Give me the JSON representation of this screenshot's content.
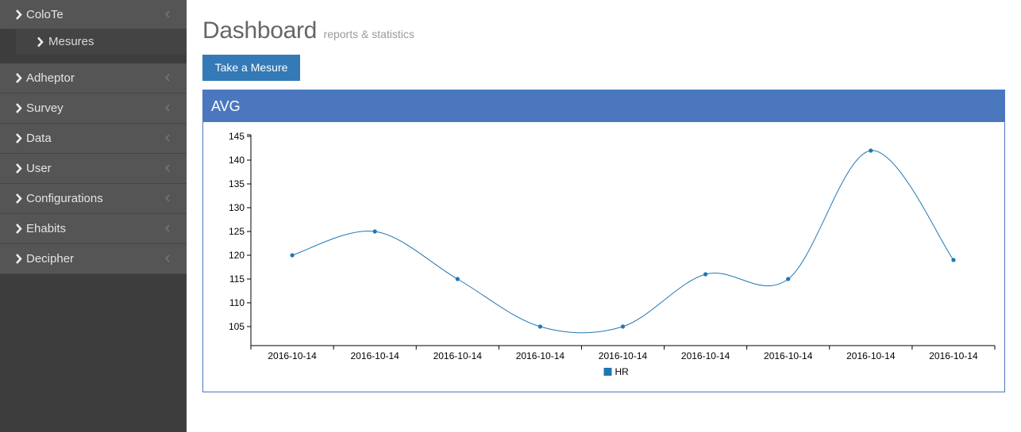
{
  "sidebar": {
    "items": [
      {
        "label": "ColoTe",
        "submenu": [
          {
            "label": "Mesures"
          }
        ]
      },
      {
        "label": "Adheptor"
      },
      {
        "label": "Survey"
      },
      {
        "label": "Data"
      },
      {
        "label": "User"
      },
      {
        "label": "Configurations"
      },
      {
        "label": "Ehabits"
      },
      {
        "label": "Decipher"
      }
    ]
  },
  "header": {
    "title": "Dashboard",
    "subtitle": "reports & statistics"
  },
  "actions": {
    "take_measure_label": "Take a Mesure"
  },
  "panel": {
    "title": "AVG"
  },
  "colors": {
    "accent": "#4b77be",
    "button": "#337ab7",
    "sidebar_bg": "#3d3d3d",
    "menu_bg": "#555555",
    "series": "#1f77b4"
  },
  "chart_data": {
    "type": "line",
    "x": [
      "2016-10-14",
      "2016-10-14",
      "2016-10-14",
      "2016-10-14",
      "2016-10-14",
      "2016-10-14",
      "2016-10-14",
      "2016-10-14",
      "2016-10-14"
    ],
    "series": [
      {
        "name": "HR",
        "values": [
          120,
          125,
          115,
          105,
          105,
          116,
          115,
          142,
          119
        ]
      }
    ],
    "ylim": [
      101,
      145
    ],
    "yticks": [
      105,
      110,
      115,
      120,
      125,
      130,
      135,
      140,
      145
    ],
    "legend": "bottom-center",
    "grid": false,
    "curve": "smooth"
  }
}
